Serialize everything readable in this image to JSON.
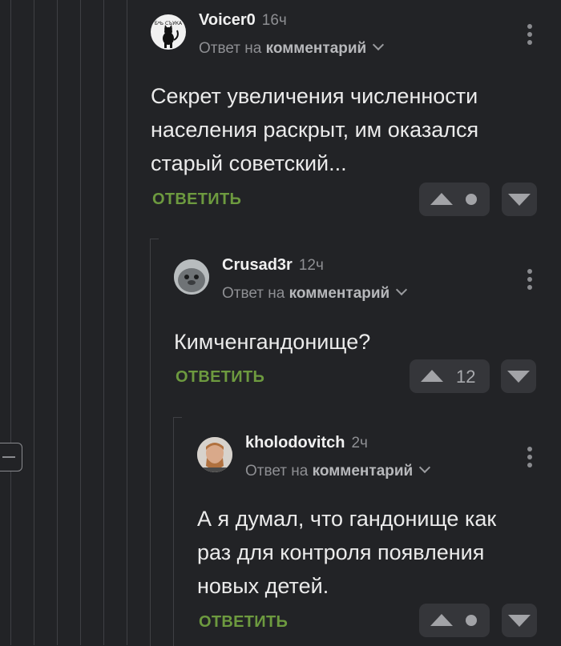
{
  "reply_label": "ОТВЕТИТЬ",
  "comments": [
    {
      "author": "Voicer0",
      "time": "16ч",
      "reply_prefix": "Ответ на",
      "reply_target": "комментарий",
      "lines": [
        "Секрет увеличения численности",
        "населения раскрыт, им оказался",
        "старый советский..."
      ],
      "score": "",
      "avatar": "cat-avatar"
    },
    {
      "author": "Crusad3r",
      "time": "12ч",
      "reply_prefix": "Ответ на",
      "reply_target": "комментарий",
      "lines": [
        "Кимченгандонище?"
      ],
      "score": "12",
      "avatar": "seal-avatar"
    },
    {
      "author": "kholodovitch",
      "time": "2ч",
      "reply_prefix": "Ответ на",
      "reply_target": "комментарий",
      "lines": [
        "А я думал, что гандонище как",
        "раз для контроля появления",
        "новых детей."
      ],
      "score": "",
      "avatar": "man-avatar"
    }
  ],
  "avatar_text": "Б*Ь СЪУКА",
  "colors": {
    "background": "#222326",
    "reply_green": "#6d9a3f",
    "vote_bg": "#35363a"
  }
}
